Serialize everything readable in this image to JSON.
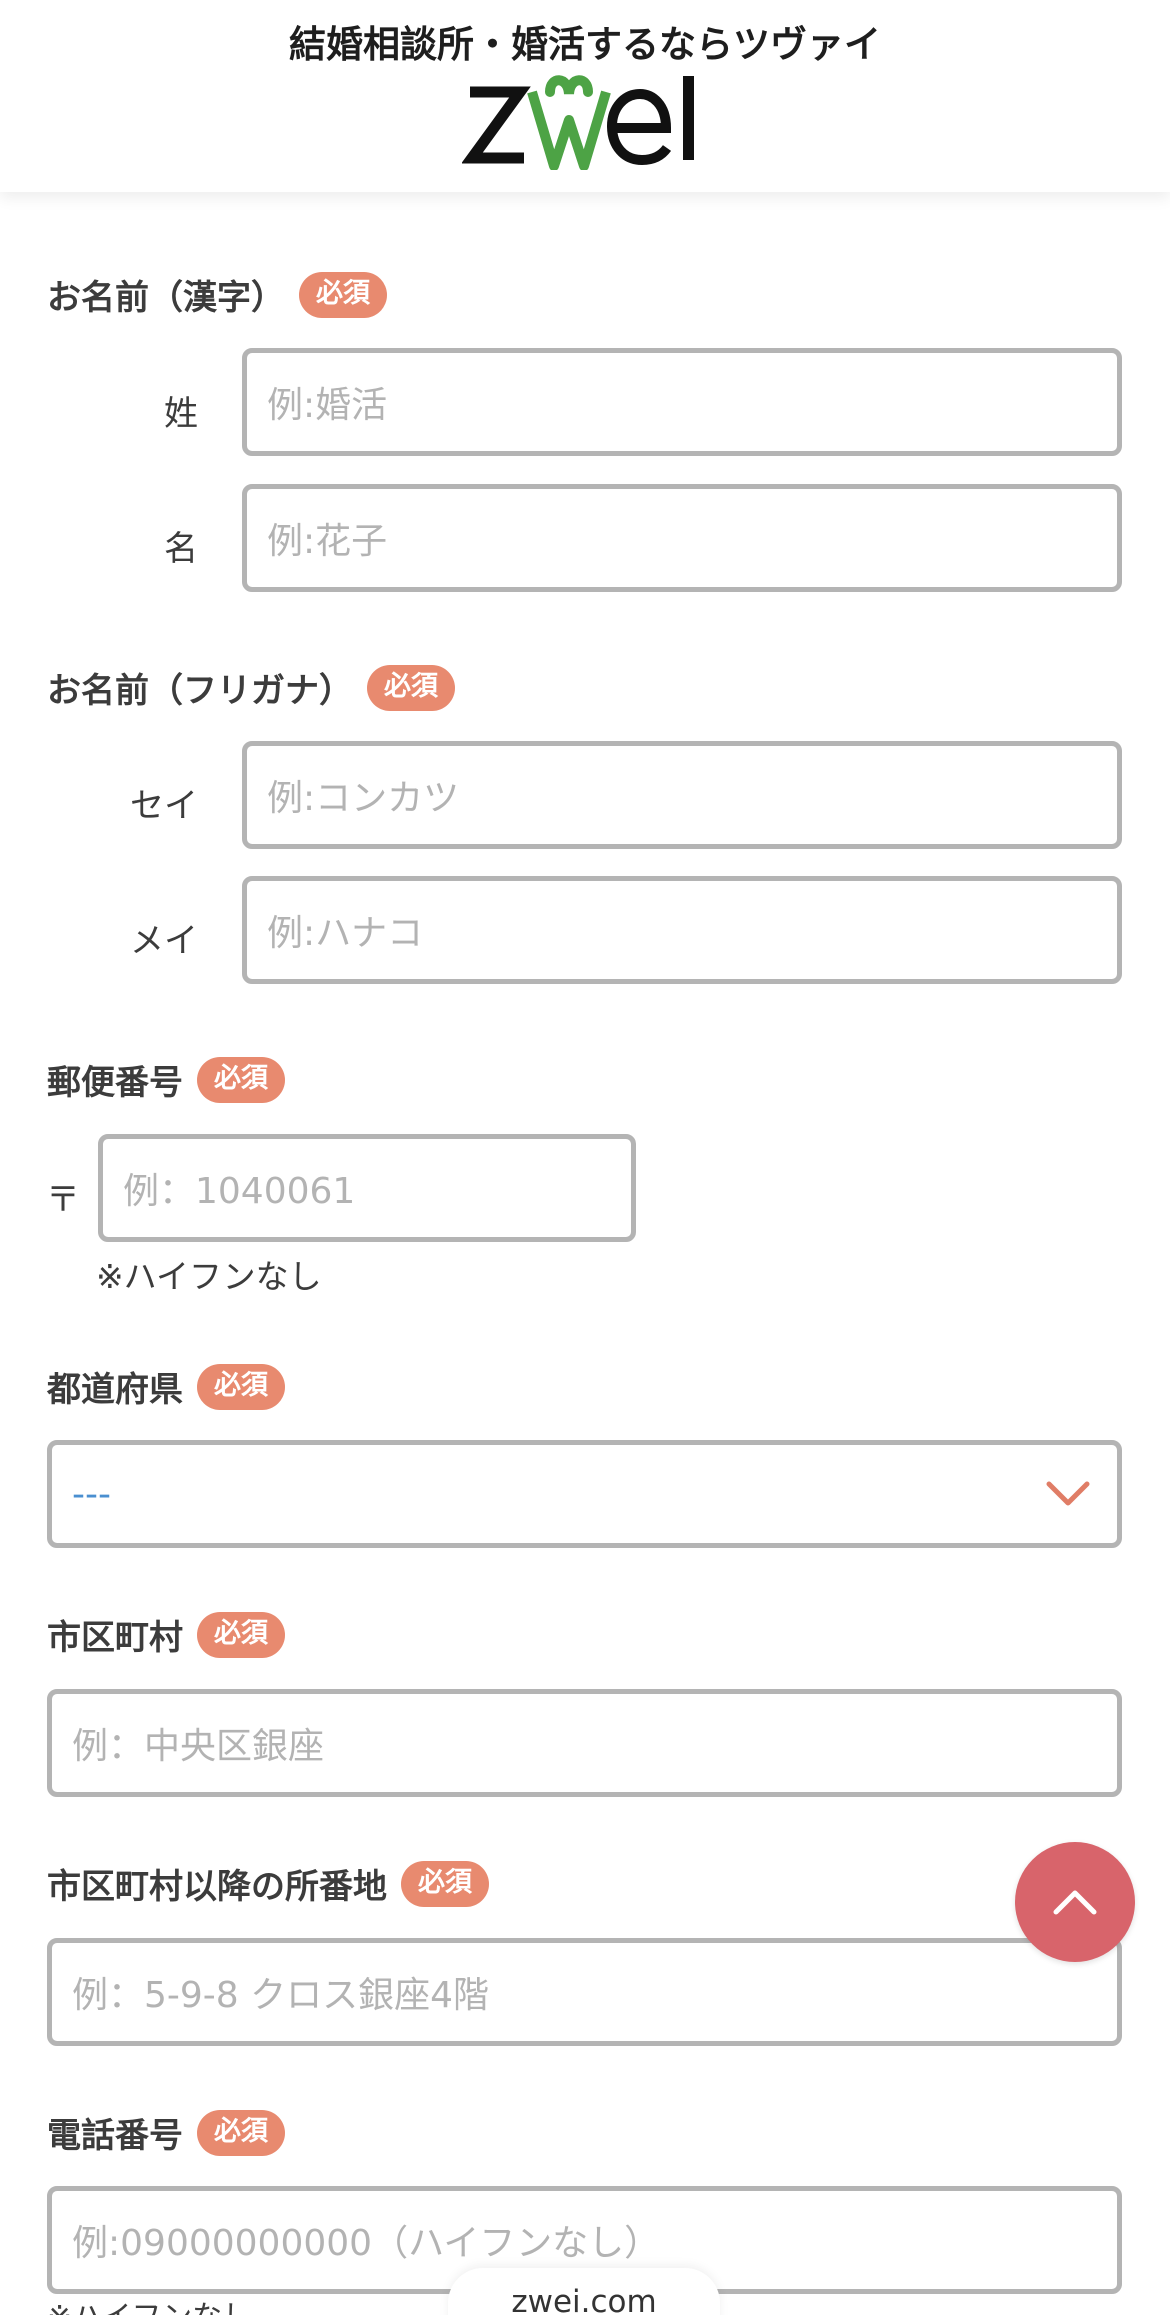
{
  "header": {
    "tagline": "結婚相談所・婚活するならツヴァイ",
    "logo_text": "zwei",
    "logo_heart_color": "#4da345"
  },
  "badge_required": "必須",
  "sections": {
    "name_kanji": {
      "label": "お名前（漢字）",
      "sei_label": "姓",
      "sei_placeholder": "例:婚活",
      "mei_label": "名",
      "mei_placeholder": "例:花子"
    },
    "name_kana": {
      "label": "お名前（フリガナ）",
      "sei_label": "セイ",
      "sei_placeholder": "例:コンカツ",
      "mei_label": "メイ",
      "mei_placeholder": "例:ハナコ"
    },
    "postal": {
      "label": "郵便番号",
      "mark": "〒",
      "placeholder": "例：1040061",
      "note": "※ハイフンなし"
    },
    "prefecture": {
      "label": "都道府県",
      "selected": "---"
    },
    "city": {
      "label": "市区町村",
      "placeholder": "例：中央区銀座"
    },
    "address": {
      "label": "市区町村以降の所番地",
      "placeholder": "例：5-9-8 クロス銀座4階"
    },
    "phone": {
      "label": "電話番号",
      "placeholder": "例:09000000000（ハイフンなし）",
      "note": "※ハイフンなし"
    }
  },
  "footer": {
    "domain": "zwei.com"
  },
  "icons": {
    "scroll_top": "chevron-up-icon",
    "select_arrow": "chevron-down-icon"
  },
  "colors": {
    "badge": "#e88a6f",
    "scroll_top_button": "#d8646b",
    "field_border": "#b4b4b4",
    "select_value": "#4a8fd0"
  }
}
